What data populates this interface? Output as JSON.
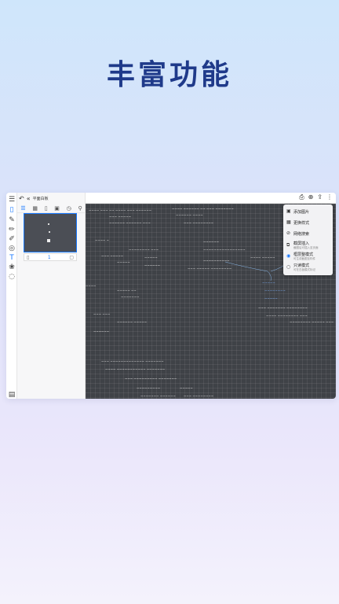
{
  "headline": "丰富功能",
  "app": {
    "title": "平面白板",
    "menu": {
      "items": [
        {
          "label": "添加图片",
          "sub": "",
          "icon": "image-icon"
        },
        {
          "label": "更换样式",
          "sub": "",
          "icon": "palette-icon"
        },
        {
          "label": "网络搜索",
          "sub": "",
          "icon": "globe-search-icon"
        },
        {
          "label": "截屏插入",
          "sub": "截图后可插入至页面",
          "icon": "screenshot-icon"
        },
        {
          "label": "框层整模式",
          "sub": "可生成截图至构件",
          "icon": "frame-mode-icon"
        },
        {
          "label": "只读模式",
          "sub": "可在白板模式标记",
          "icon": "readonly-icon"
        }
      ]
    },
    "page_indicator": "1"
  }
}
